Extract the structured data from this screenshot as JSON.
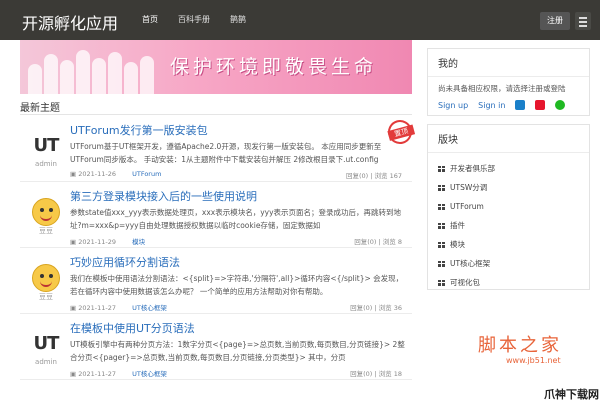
{
  "header": {
    "site_title": "开源孵化应用",
    "nav": [
      {
        "label": "首页"
      },
      {
        "label": "百科手册"
      },
      {
        "label": "鹊鹊"
      }
    ],
    "register_label": "注册"
  },
  "banner": {
    "text": "保护环境即敬畏生命"
  },
  "main": {
    "section_title": "最新主题",
    "topics": [
      {
        "title": "UTForum发行第一版安装包",
        "excerpt": "UTForum基于UT框架开发，遵循Apache2.0开源，现发行第一版安装包。 本应用同步更新至UTForum同步版本。 手动安装：1从主题附件中下载安装包并解压 2修改根目录下.ut.config",
        "author": "admin",
        "date": "2021-11-26",
        "category": "UTForum",
        "stats": "回复(0) | 浏览 167",
        "stamp": "置顶"
      },
      {
        "title": "第三方登录模块接入后的一些使用说明",
        "excerpt": "参数state值xxx_yyy表示数据处理页，xxx表示模块名，yyy表示页面名；登录成功后，再跳转到地址?m=xxx&p=yyy自由处理数据授权数据以临时cookie存储，固定数据如",
        "author": "豆豆",
        "date": "2021-11-29",
        "category": "模块",
        "stats": "回复(0) | 浏览 8"
      },
      {
        "title": "巧妙应用循环分割语法",
        "excerpt": "我们在模板中使用语法分割语法：<{split}=>字符串,'分隔符',all}>循环内容<{/split}> 会发现，若在循环内容中使用数据该怎么办呢？ 一个简单的应用方法帮助对你有帮助。",
        "author": "豆豆",
        "date": "2021-11-27",
        "category": "UT核心框架",
        "stats": "回复(0) | 浏览 36"
      },
      {
        "title": "在模板中使用UT分页语法",
        "excerpt": "UT模板引擎中有两种分页方法：1数字分页<{page}=>总页数,当前页数,每页数目,分页链接}> 2整合分页<{pager}=>总页数,当前页数,每页数目,分页链接,分页类型}> 其中，分页",
        "author": "admin",
        "date": "2021-11-27",
        "category": "UT核心框架",
        "stats": "回复(0) | 浏览 18"
      }
    ]
  },
  "sidebar": {
    "my": {
      "title": "我的",
      "text": "尚未具备相应权限，请选择注册或登陆",
      "signup_label": "Sign up",
      "signin_label": "Sign in"
    },
    "forums": {
      "title": "版块",
      "items": [
        {
          "label": "开发者俱乐部"
        },
        {
          "label": "UTSW分调"
        },
        {
          "label": "UTForum"
        },
        {
          "label": "插件"
        },
        {
          "label": "模块"
        },
        {
          "label": "UT核心框架"
        },
        {
          "label": "可视化包"
        }
      ]
    }
  },
  "watermarks": {
    "jb51_text": "脚本之家",
    "jb51_url": "www.jb51.net",
    "pc_text": "爪神下载网"
  }
}
